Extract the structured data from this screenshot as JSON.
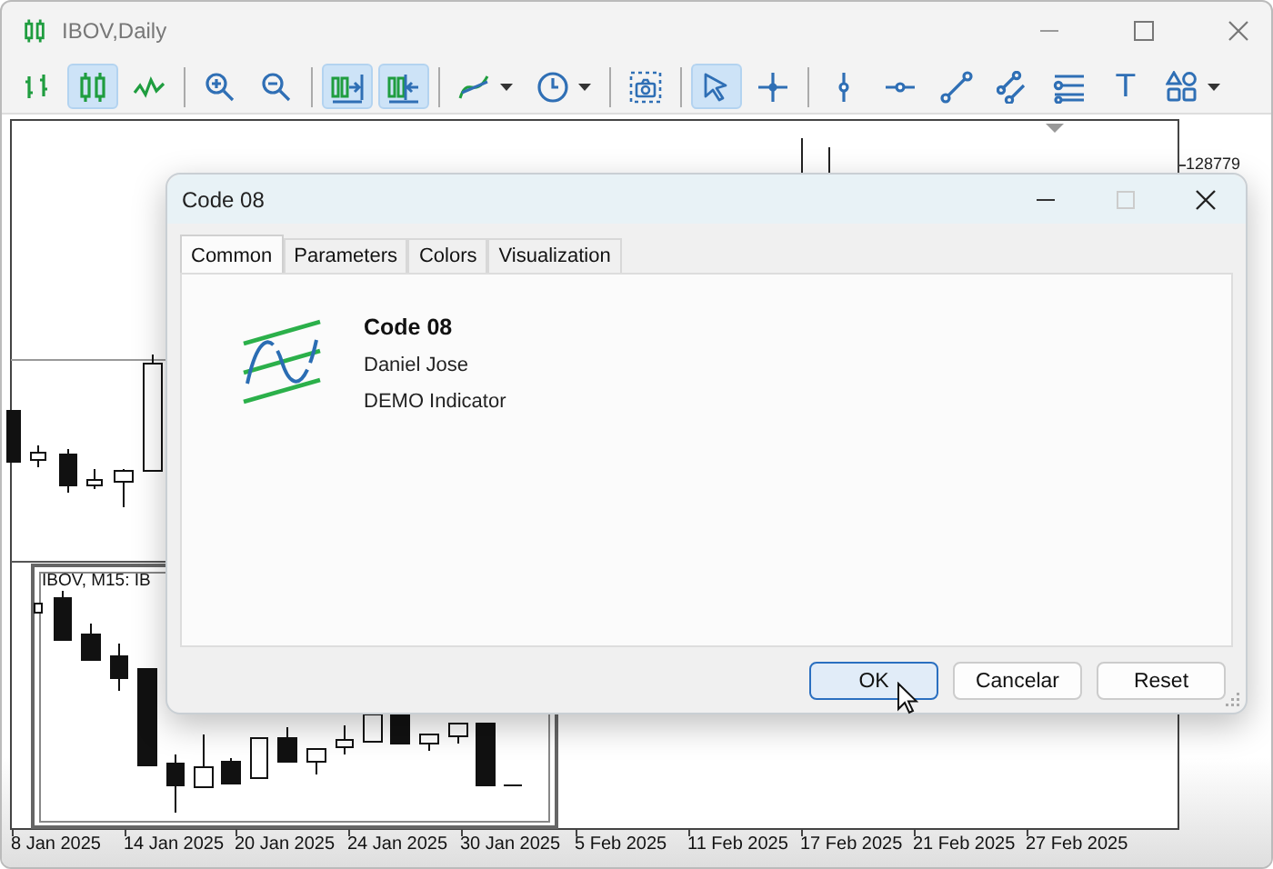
{
  "window": {
    "title": "IBOV,Daily"
  },
  "toolbar": {
    "groups": [
      [
        {
          "selected": false
        },
        {
          "selected": true
        },
        {
          "selected": false
        }
      ],
      [
        {
          "selected": false
        },
        {
          "selected": false
        }
      ],
      [
        {
          "selected": true
        },
        {
          "selected": true
        }
      ],
      [
        {
          "selected": false,
          "dropdown": true
        },
        {
          "selected": false,
          "dropdown": true
        }
      ],
      [
        {
          "selected": false
        }
      ],
      [
        {
          "selected": true
        },
        {
          "selected": false
        }
      ],
      [
        {
          "selected": false
        },
        {
          "selected": false
        },
        {
          "selected": false
        },
        {
          "selected": false
        },
        {
          "selected": false
        },
        {
          "selected": false,
          "label": "T"
        },
        {
          "selected": false,
          "dropdown": true
        }
      ]
    ]
  },
  "chart": {
    "price_label": "128779",
    "subwindow_title": "IBOV, M15: IB",
    "date_labels": [
      "8 Jan 2025",
      "14 Jan 2025",
      "20 Jan 2025",
      "24 Jan 2025",
      "30 Jan 2025",
      "5 Feb 2025",
      "11 Feb 2025",
      "17 Feb 2025",
      "21 Feb 2025",
      "27 Feb 2025"
    ]
  },
  "dialog": {
    "title": "Code 08",
    "tabs": [
      {
        "label": "Common",
        "selected": true
      },
      {
        "label": "Parameters",
        "selected": false
      },
      {
        "label": "Colors",
        "selected": false
      },
      {
        "label": "Visualization",
        "selected": false
      }
    ],
    "name": "Code 08",
    "author": "Daniel Jose",
    "description": "DEMO Indicator",
    "buttons": [
      {
        "label": "OK",
        "default": true
      },
      {
        "label": "Cancelar",
        "default": false
      },
      {
        "label": "Reset",
        "default": false
      }
    ]
  }
}
